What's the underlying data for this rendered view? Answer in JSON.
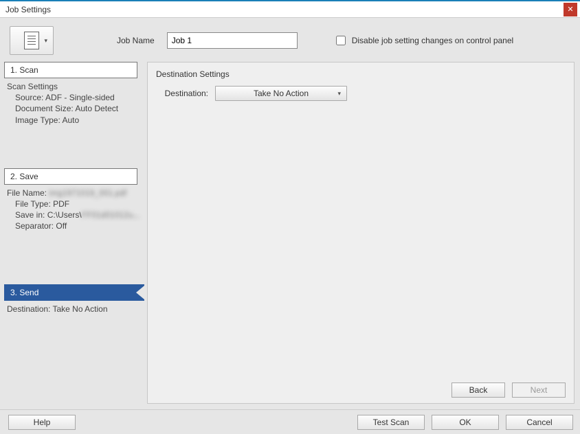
{
  "window": {
    "title": "Job Settings"
  },
  "header": {
    "job_name_label": "Job Name",
    "job_name_value": "Job 1",
    "disable_checkbox_label": "Disable job setting changes on control panel"
  },
  "sidebar": {
    "scan": {
      "title": "1. Scan",
      "heading": "Scan Settings",
      "source": "Source: ADF - Single-sided",
      "docsize": "Document Size: Auto Detect",
      "imgtype": "Image Type: Auto"
    },
    "save": {
      "title": "2. Save",
      "filename_label": "File Name:",
      "filename_value": "img1971019_001.pdf",
      "filetype": "File Type: PDF",
      "savein_label": "Save in: C:\\Users\\",
      "savein_value": "FF01d01012u...",
      "separator": "Separator: Off"
    },
    "send": {
      "title": "3. Send",
      "destination": "Destination: Take No Action"
    }
  },
  "main": {
    "panel_title": "Destination Settings",
    "destination_label": "Destination:",
    "destination_value": "Take No Action",
    "back_label": "Back",
    "next_label": "Next"
  },
  "footer": {
    "help": "Help",
    "test_scan": "Test Scan",
    "ok": "OK",
    "cancel": "Cancel"
  }
}
